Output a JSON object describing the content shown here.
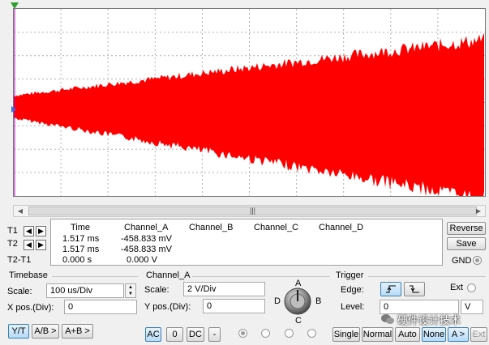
{
  "scope": {
    "horizontal_divisions": 10,
    "vertical_divisions": 8,
    "trace_color": "#ff0000",
    "background": "#ffffff"
  },
  "cursors": {
    "rows": [
      {
        "label": "T1",
        "time": "1.517 ms",
        "channel_a": "-458.833 mV",
        "channel_b": "",
        "channel_c": "",
        "channel_d": ""
      },
      {
        "label": "T2",
        "time": "1.517 ms",
        "channel_a": "-458.833 mV",
        "channel_b": "",
        "channel_c": "",
        "channel_d": ""
      },
      {
        "label": "T2-T1",
        "time": "0.000 s",
        "channel_a": "0.000 V",
        "channel_b": "",
        "channel_c": "",
        "channel_d": ""
      }
    ],
    "headers": {
      "time": "Time",
      "channel_a": "Channel_A",
      "channel_b": "Channel_B",
      "channel_c": "Channel_C",
      "channel_d": "Channel_D"
    }
  },
  "side_buttons": {
    "reverse": "Reverse",
    "save": "Save",
    "gnd": "GND"
  },
  "timebase": {
    "title": "Timebase",
    "scale_label": "Scale:",
    "scale_value": "100 us/Div",
    "xpos_label": "X pos.(Div):",
    "xpos_value": "0",
    "buttons": [
      "Y/T",
      "A/B >",
      "A+B >"
    ]
  },
  "channel_a": {
    "title": "Channel_A",
    "scale_label": "Scale:",
    "scale_value": "2  V/Div",
    "ypos_label": "Y pos.(Div):",
    "ypos_value": "0",
    "buttons": [
      "AC",
      "0",
      "DC",
      "-"
    ],
    "knob_labels": {
      "a": "A",
      "b": "B",
      "c": "C",
      "d": "D"
    }
  },
  "trigger": {
    "title": "Trigger",
    "edge_label": "Edge:",
    "ext_label": "Ext",
    "level_label": "Level:",
    "level_value": "0",
    "level_unit": "V",
    "mode_buttons": [
      "Single",
      "Normal",
      "Auto",
      "None",
      "A >",
      "Ext"
    ]
  },
  "watermark": "硬件设计技术",
  "colors": {
    "accent_blue": "#3c7fb1",
    "trace": "#ff0000"
  }
}
